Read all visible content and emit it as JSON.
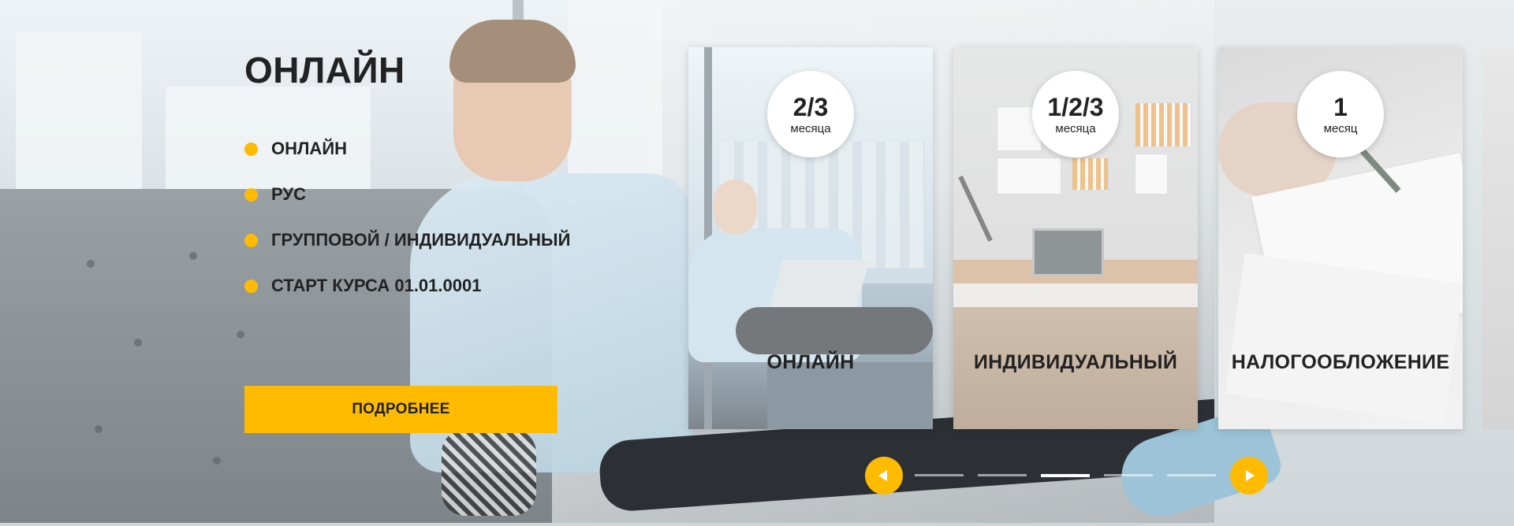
{
  "hero": {
    "title": "ОНЛАЙН",
    "features": [
      "ОНЛАЙН",
      "РУС",
      "ГРУППОВОЙ / ИНДИВИДУАЛЬНЫЙ",
      "СТАРТ КУРСА 01.01.0001"
    ],
    "more_label": "ПОДРОБНЕЕ"
  },
  "cards": [
    {
      "duration": "2/3",
      "unit": "месяца",
      "label": "ОНЛАЙН"
    },
    {
      "duration": "1/2/3",
      "unit": "месяца",
      "label": "ИНДИВИДУАЛЬНЫЙ"
    },
    {
      "duration": "1",
      "unit": "месяц",
      "label": "НАЛОГООБЛОЖЕНИЕ"
    }
  ],
  "slider": {
    "dot_count": 5,
    "active_dot": 2
  },
  "colors": {
    "accent": "#ffbb00",
    "text": "#222222"
  },
  "icons": {
    "prev": "arrow-left-icon",
    "next": "arrow-right-icon",
    "bullet": "bullet-dot-icon"
  }
}
